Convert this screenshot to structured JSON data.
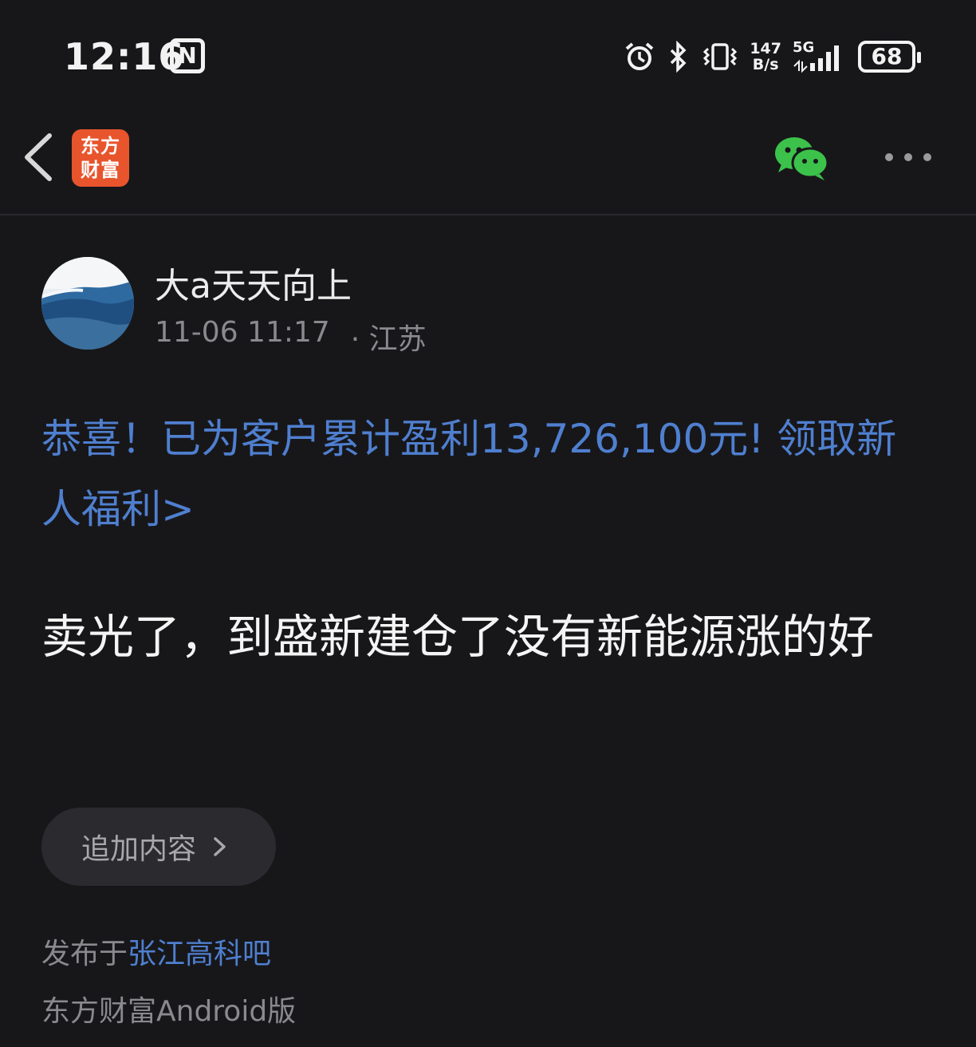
{
  "status_bar": {
    "time": "12:16",
    "nfc_label": "N",
    "net_speed_value": "147",
    "net_speed_unit": "B/s",
    "network": "5G",
    "battery": "68",
    "icons": [
      "alarm-icon",
      "bluetooth-icon",
      "vibrate-icon",
      "signal-icon"
    ]
  },
  "header": {
    "logo_line1": "东方",
    "logo_line2": "财富",
    "logo_color": "#e8542c",
    "icons": [
      "back-icon",
      "wechat-icon",
      "more-icon"
    ]
  },
  "post": {
    "author_name": "大a天天向上",
    "datetime": "11-06 11:17",
    "location": "· 江苏",
    "promo_text": "恭喜！已为客户累计盈利13,726,100元! 领取新人福利>",
    "body_text": "卖光了，到盛新建仓了没有新能源涨的好",
    "append_label": "追加内容",
    "published_prefix": "发布于",
    "forum_name": "张江高科吧",
    "platform": "东方财富Android版"
  },
  "colors": {
    "background": "#17171a",
    "link_blue": "#4f7fcf",
    "muted_text": "#8a8a8e",
    "button_bg": "#2b2b2f",
    "wechat_green": "#3cc24a"
  }
}
